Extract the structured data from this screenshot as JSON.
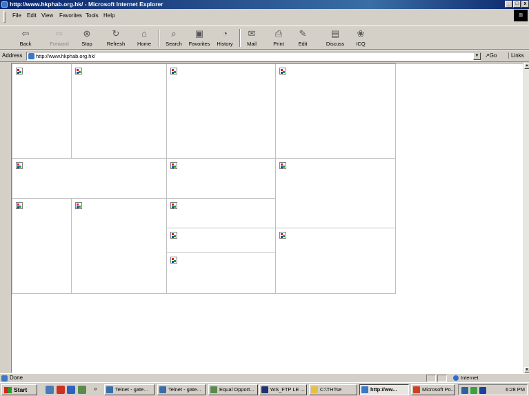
{
  "window": {
    "title": "http://www.hkphab.org.hk/ - Microsoft Internet Explorer",
    "controls": [
      "_",
      "□",
      "x"
    ]
  },
  "menu": [
    "File",
    "Edit",
    "View",
    "Favorites",
    "Tools",
    "Help"
  ],
  "toolbar": {
    "back": "Back",
    "forward": "Forward",
    "stop": "Stop",
    "refresh": "Refresh",
    "home": "Home",
    "search": "Search",
    "favorites": "Favorites",
    "history": "History",
    "mail": "Mail",
    "print": "Print",
    "edit": "Edit",
    "discuss": "Discuss",
    "icq": "ICQ"
  },
  "address": {
    "label": "Address",
    "url": "http://www.hkphab.org.hk/",
    "go": "Go",
    "links": "Links"
  },
  "status": {
    "text": "Done",
    "zone": "Internet"
  },
  "taskbar": {
    "start": "Start",
    "more": "»",
    "tasks": [
      "Telnet - gate...",
      "Telnet - gate...",
      "Equal Opport...",
      "WS_FTP LE ...",
      "C:\\THTse",
      "http://ww...",
      "Microsoft Po..."
    ],
    "clock": "6:28 PM"
  },
  "colors": {
    "title_bar": "#0a246a",
    "chrome": "#d4d0c8",
    "page_background": "#ffffff"
  }
}
